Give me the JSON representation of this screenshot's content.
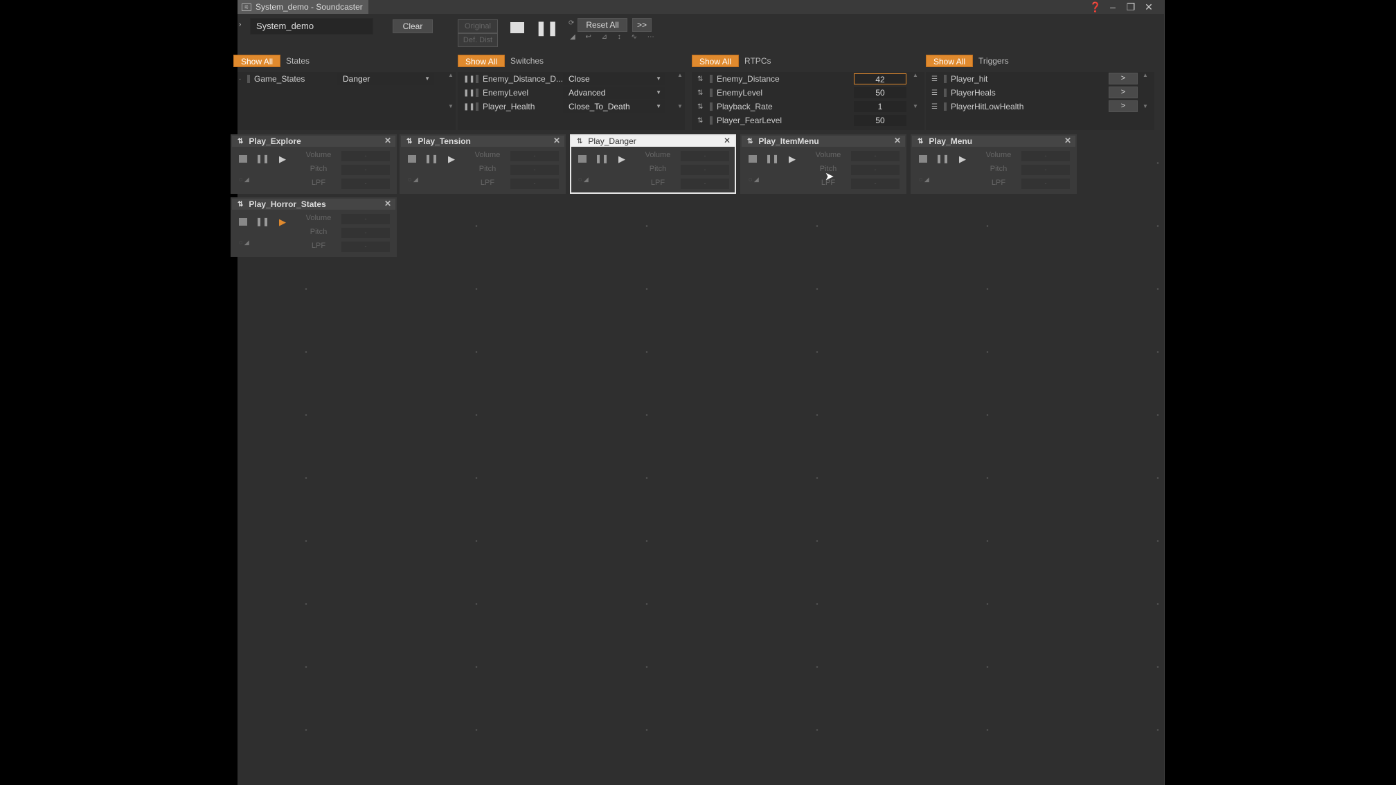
{
  "window": {
    "title": "System_demo - Soundcaster"
  },
  "toolbar": {
    "session_value": "System_demo",
    "clear_label": "Clear",
    "original_label": "Original",
    "dist_label": "Def. Dist",
    "reset_all_label": "Reset All",
    "more_label": ">>"
  },
  "states": {
    "show_all": "Show All",
    "title": "States",
    "rows": [
      {
        "name": "Game_States",
        "value": "Danger"
      }
    ]
  },
  "switches": {
    "show_all": "Show All",
    "title": "Switches",
    "rows": [
      {
        "name": "Enemy_Distance_D...",
        "value": "Close"
      },
      {
        "name": "EnemyLevel",
        "value": "Advanced"
      },
      {
        "name": "Player_Health",
        "value": "Close_To_Death"
      }
    ]
  },
  "rtpcs": {
    "show_all": "Show All",
    "title": "RTPCs",
    "rows": [
      {
        "name": "Enemy_Distance",
        "value": "42"
      },
      {
        "name": "EnemyLevel",
        "value": "50"
      },
      {
        "name": "Playback_Rate",
        "value": "1"
      },
      {
        "name": "Player_FearLevel",
        "value": "50"
      }
    ]
  },
  "triggers": {
    "show_all": "Show All",
    "title": "Triggers",
    "fire_label": ">",
    "rows": [
      {
        "name": "Player_hit"
      },
      {
        "name": "PlayerHeals"
      },
      {
        "name": "PlayerHitLowHealth"
      }
    ]
  },
  "cards": [
    {
      "name": "Play_Explore",
      "active": false,
      "playing": false
    },
    {
      "name": "Play_Tension",
      "active": false,
      "playing": false
    },
    {
      "name": "Play_Danger",
      "active": true,
      "playing": false
    },
    {
      "name": "Play_ItemMenu",
      "active": false,
      "playing": false
    },
    {
      "name": "Play_Menu",
      "active": false,
      "playing": false
    },
    {
      "name": "Play_Horror_States",
      "active": false,
      "playing": true
    }
  ],
  "card_labels": {
    "volume": "Volume",
    "pitch": "Pitch",
    "lpf": "LPF"
  },
  "colors": {
    "accent": "#e08a2e",
    "background": "#2f2f2f"
  },
  "icons": [
    "stop-icon",
    "pause-icon",
    "play-icon",
    "close-icon",
    "help-icon",
    "minimize-icon",
    "maximize-icon"
  ]
}
